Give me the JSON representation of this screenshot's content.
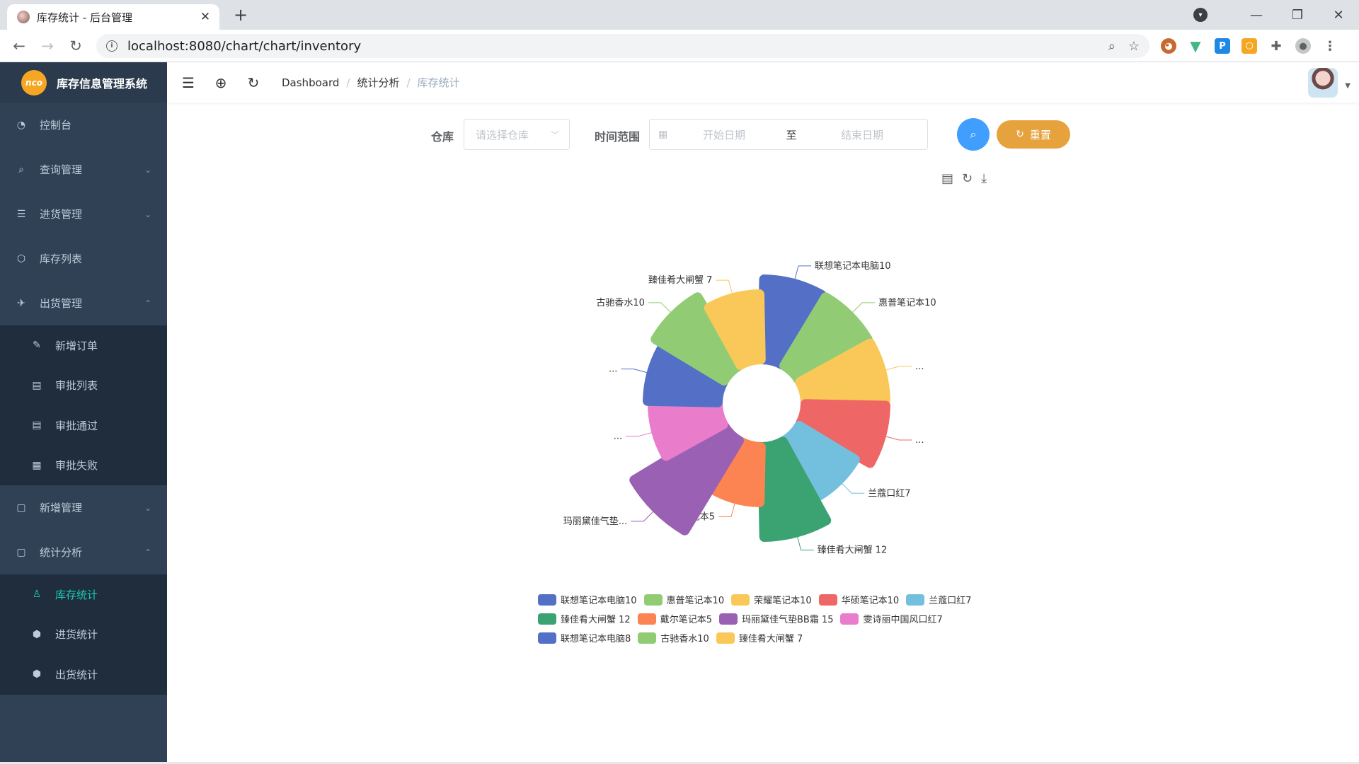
{
  "browser": {
    "tab_title": "库存统计 - 后台管理",
    "url": "localhost:8080/chart/chart/inventory"
  },
  "sidebar": {
    "app_name": "库存信息管理系统",
    "logo_text": "nco",
    "items": [
      {
        "label": "控制台",
        "icon": "dashboard-icon"
      },
      {
        "label": "查询管理",
        "icon": "query-icon",
        "arrow": "⌄"
      },
      {
        "label": "进货管理",
        "icon": "purchase-icon",
        "arrow": "⌄"
      },
      {
        "label": "库存列表",
        "icon": "box-icon"
      },
      {
        "label": "出货管理",
        "icon": "shipment-icon",
        "arrow": "⌃"
      }
    ],
    "shipment_sub": [
      {
        "label": "新增订单",
        "icon": "add-order-icon"
      },
      {
        "label": "审批列表",
        "icon": "list-icon"
      },
      {
        "label": "审批通过",
        "icon": "approved-icon"
      },
      {
        "label": "审批失败",
        "icon": "rejected-icon"
      }
    ],
    "items2": [
      {
        "label": "新增管理",
        "icon": "add-icon",
        "arrow": "⌄"
      },
      {
        "label": "统计分析",
        "icon": "stats-icon",
        "arrow": "⌃"
      }
    ],
    "stats_sub": [
      {
        "label": "库存统计",
        "icon": "user-icon",
        "active": true
      },
      {
        "label": "进货统计",
        "icon": "cube-icon"
      },
      {
        "label": "出货统计",
        "icon": "cube-icon"
      }
    ]
  },
  "navbar": {
    "breadcrumb": [
      "Dashboard",
      "统计分析",
      "库存统计"
    ],
    "separator": "/"
  },
  "filters": {
    "warehouse_label": "仓库",
    "warehouse_placeholder": "请选择仓库",
    "time_label": "时间范围",
    "start_placeholder": "开始日期",
    "range_separator": "至",
    "end_placeholder": "结束日期",
    "reset_label": "重置"
  },
  "chart_data": {
    "type": "pie",
    "subtype": "rose",
    "series": [
      {
        "name": "联想笔记本电脑10",
        "value": 10,
        "color": "#5470c6",
        "label": "联想笔记本电脑10"
      },
      {
        "name": "惠普笔记本10",
        "value": 10,
        "color": "#91cc75",
        "label": "惠普笔记本10"
      },
      {
        "name": "荣耀笔记本10",
        "value": 10,
        "color": "#fac858",
        "label": "..."
      },
      {
        "name": "华硕笔记本10",
        "value": 10,
        "color": "#ee6666",
        "label": "..."
      },
      {
        "name": "兰蔻口红7",
        "value": 7,
        "color": "#73c0de",
        "label": "兰蔻口红7"
      },
      {
        "name": "臻佳肴大闸蟹 12",
        "value": 12,
        "color": "#3ba272",
        "label": "臻佳肴大闸蟹 12"
      },
      {
        "name": "戴尔笔记本5",
        "value": 5,
        "color": "#fc8452",
        "label": "戴尔笔记本5"
      },
      {
        "name": "玛丽黛佳气垫BB霜 15",
        "value": 15,
        "color": "#9a60b4",
        "label": "玛丽黛佳气垫..."
      },
      {
        "name": "雯诗丽中国风口红7",
        "value": 7,
        "color": "#ea7ccc",
        "label": "..."
      },
      {
        "name": "联想笔记本电脑8",
        "value": 8,
        "color": "#5470c6",
        "label": "..."
      },
      {
        "name": "古驰香水10",
        "value": 10,
        "color": "#91cc75",
        "label": "古驰香水10"
      },
      {
        "name": "臻佳肴大闸蟹 7",
        "value": 7,
        "color": "#fac858",
        "label": "臻佳肴大闸蟹 7"
      }
    ]
  }
}
